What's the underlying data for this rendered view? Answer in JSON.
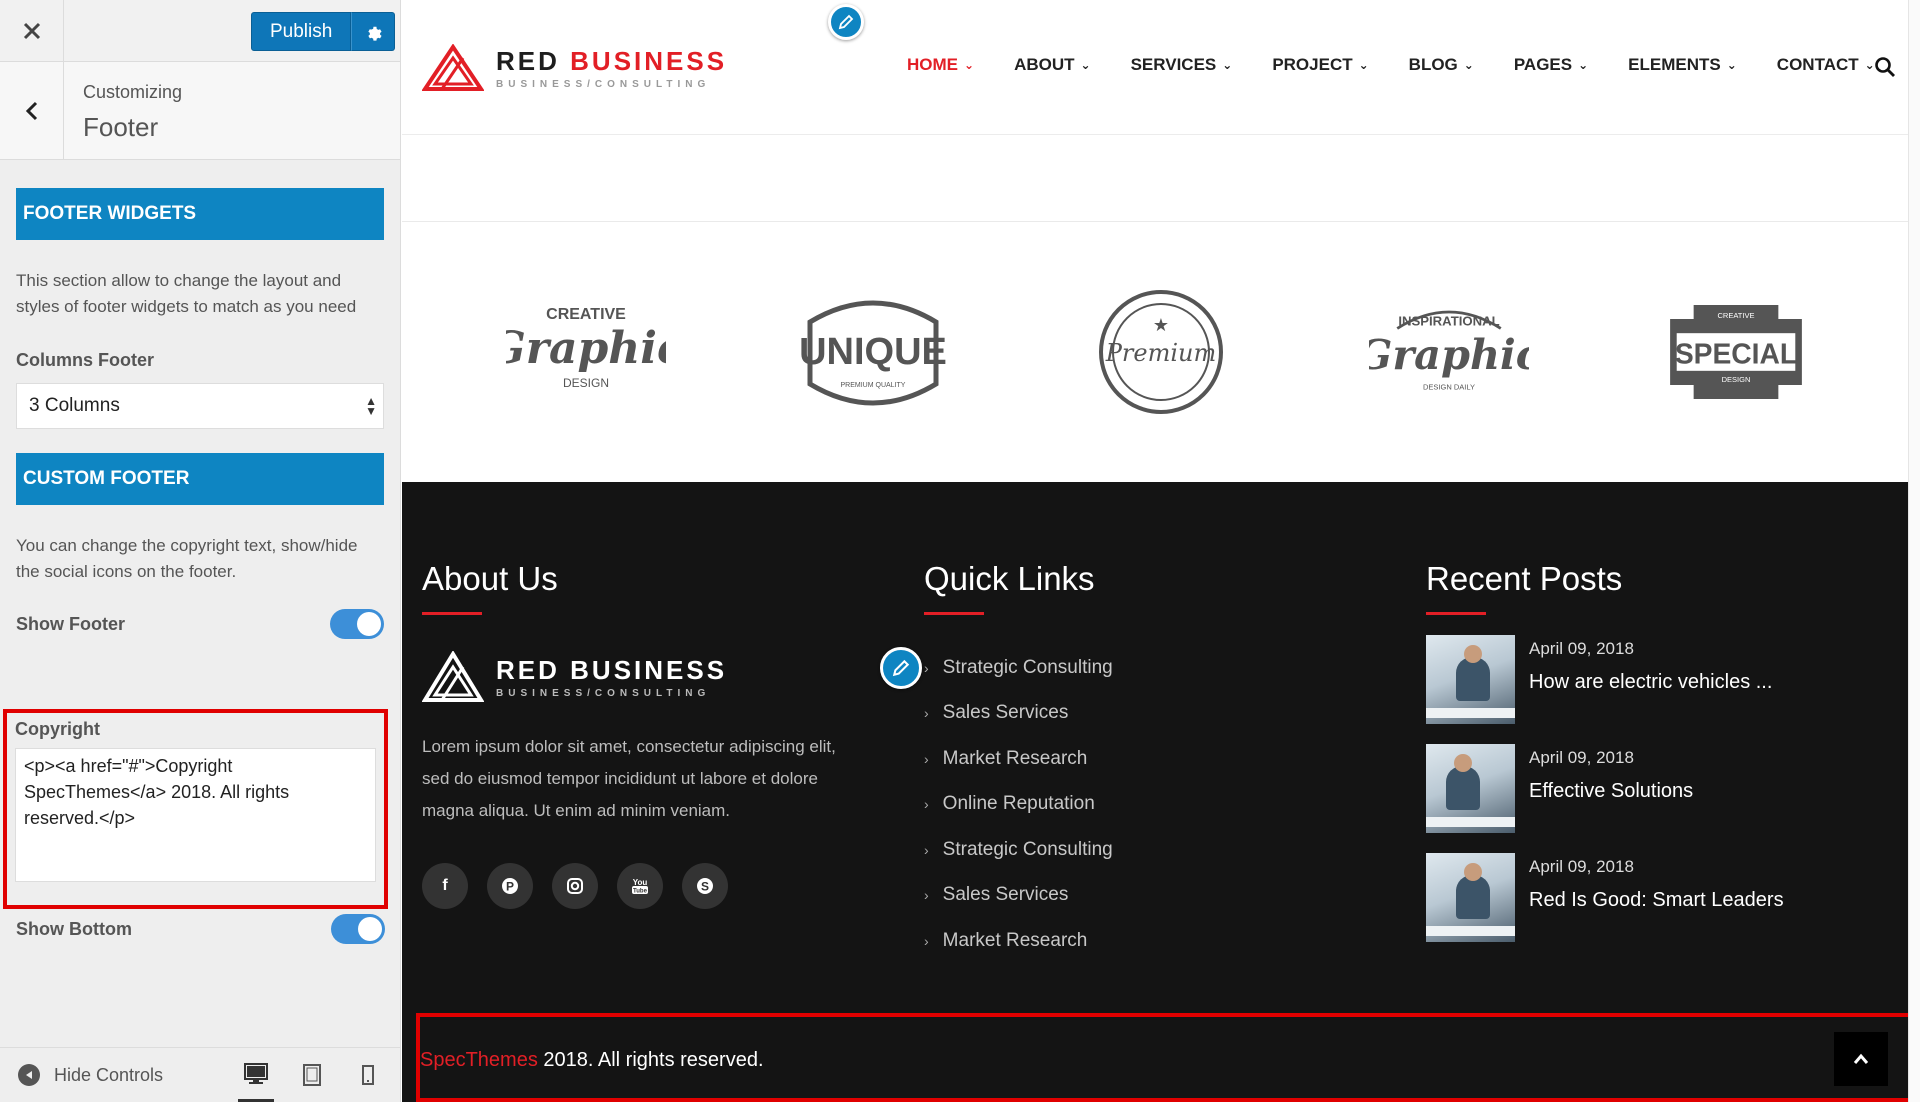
{
  "sidebar": {
    "publish_label": "Publish",
    "customizing_label": "Customizing",
    "section_title": "Footer",
    "footer_widgets": {
      "title": "FOOTER WIDGETS",
      "description": "This section allow to change the layout and styles of footer widgets to match as you need",
      "columns_label": "Columns Footer",
      "columns_value": "3 Columns"
    },
    "custom_footer": {
      "title": "CUSTOM FOOTER",
      "description": "You can change the copyright text, show/hide the social icons on the footer.",
      "show_footer_label": "Show Footer",
      "show_footer_on": true,
      "copyright_label": "Copyright",
      "copyright_value": "<p><a href=\"#\">Copyright SpecThemes</a> 2018. All rights reserved.</p>",
      "show_bottom_label": "Show Bottom",
      "show_bottom_on": true
    },
    "hide_controls_label": "Hide Controls",
    "accent_color": "#0e85c2"
  },
  "preview": {
    "logo": {
      "name_part1": "RED",
      "name_part2": "BUSINESS",
      "tagline": "BUSINESS/CONSULTING"
    },
    "nav": [
      {
        "label": "HOME",
        "active": true
      },
      {
        "label": "ABOUT"
      },
      {
        "label": "SERVICES"
      },
      {
        "label": "PROJECT"
      },
      {
        "label": "BLOG"
      },
      {
        "label": "PAGES"
      },
      {
        "label": "ELEMENTS"
      },
      {
        "label": "CONTACT"
      }
    ],
    "brands": [
      {
        "top": "CREATIVE",
        "main": "Graphic",
        "bottom": "DESIGN"
      },
      {
        "main": "UNIQUE",
        "bottom": "PREMIUM QUALITY"
      },
      {
        "main": "Premium"
      },
      {
        "top": "INSPIRATIONAL",
        "main": "Graphic",
        "bottom": "DESIGN DAILY"
      },
      {
        "top": "CREATIVE",
        "main": "SPECIAL",
        "bottom": "DESIGN"
      }
    ],
    "footer": {
      "about": {
        "title": "About Us",
        "text": "Lorem ipsum dolor sit amet, consectetur adipiscing elit, sed do eiusmod tempor incididunt ut labore et dolore magna aliqua. Ut enim ad minim veniam."
      },
      "social_icons": [
        "facebook-icon",
        "pinterest-icon",
        "instagram-icon",
        "youtube-icon",
        "skype-icon"
      ],
      "quick_links": {
        "title": "Quick Links",
        "items": [
          "Strategic Consulting",
          "Sales Services",
          "Market Research",
          "Online Reputation",
          "Strategic Consulting",
          "Sales Services",
          "Market Research"
        ]
      },
      "recent_posts": {
        "title": "Recent Posts",
        "items": [
          {
            "date": "April 09, 2018",
            "title": "How are electric vehicles ..."
          },
          {
            "date": "April 09, 2018",
            "title": "Effective Solutions"
          },
          {
            "date": "April 09, 2018",
            "title": "Red Is Good: Smart Leaders"
          }
        ]
      },
      "copyright": {
        "brand": "SpecThemes",
        "rest": " 2018. All rights reserved."
      }
    },
    "brand_red": "#e21f26"
  }
}
